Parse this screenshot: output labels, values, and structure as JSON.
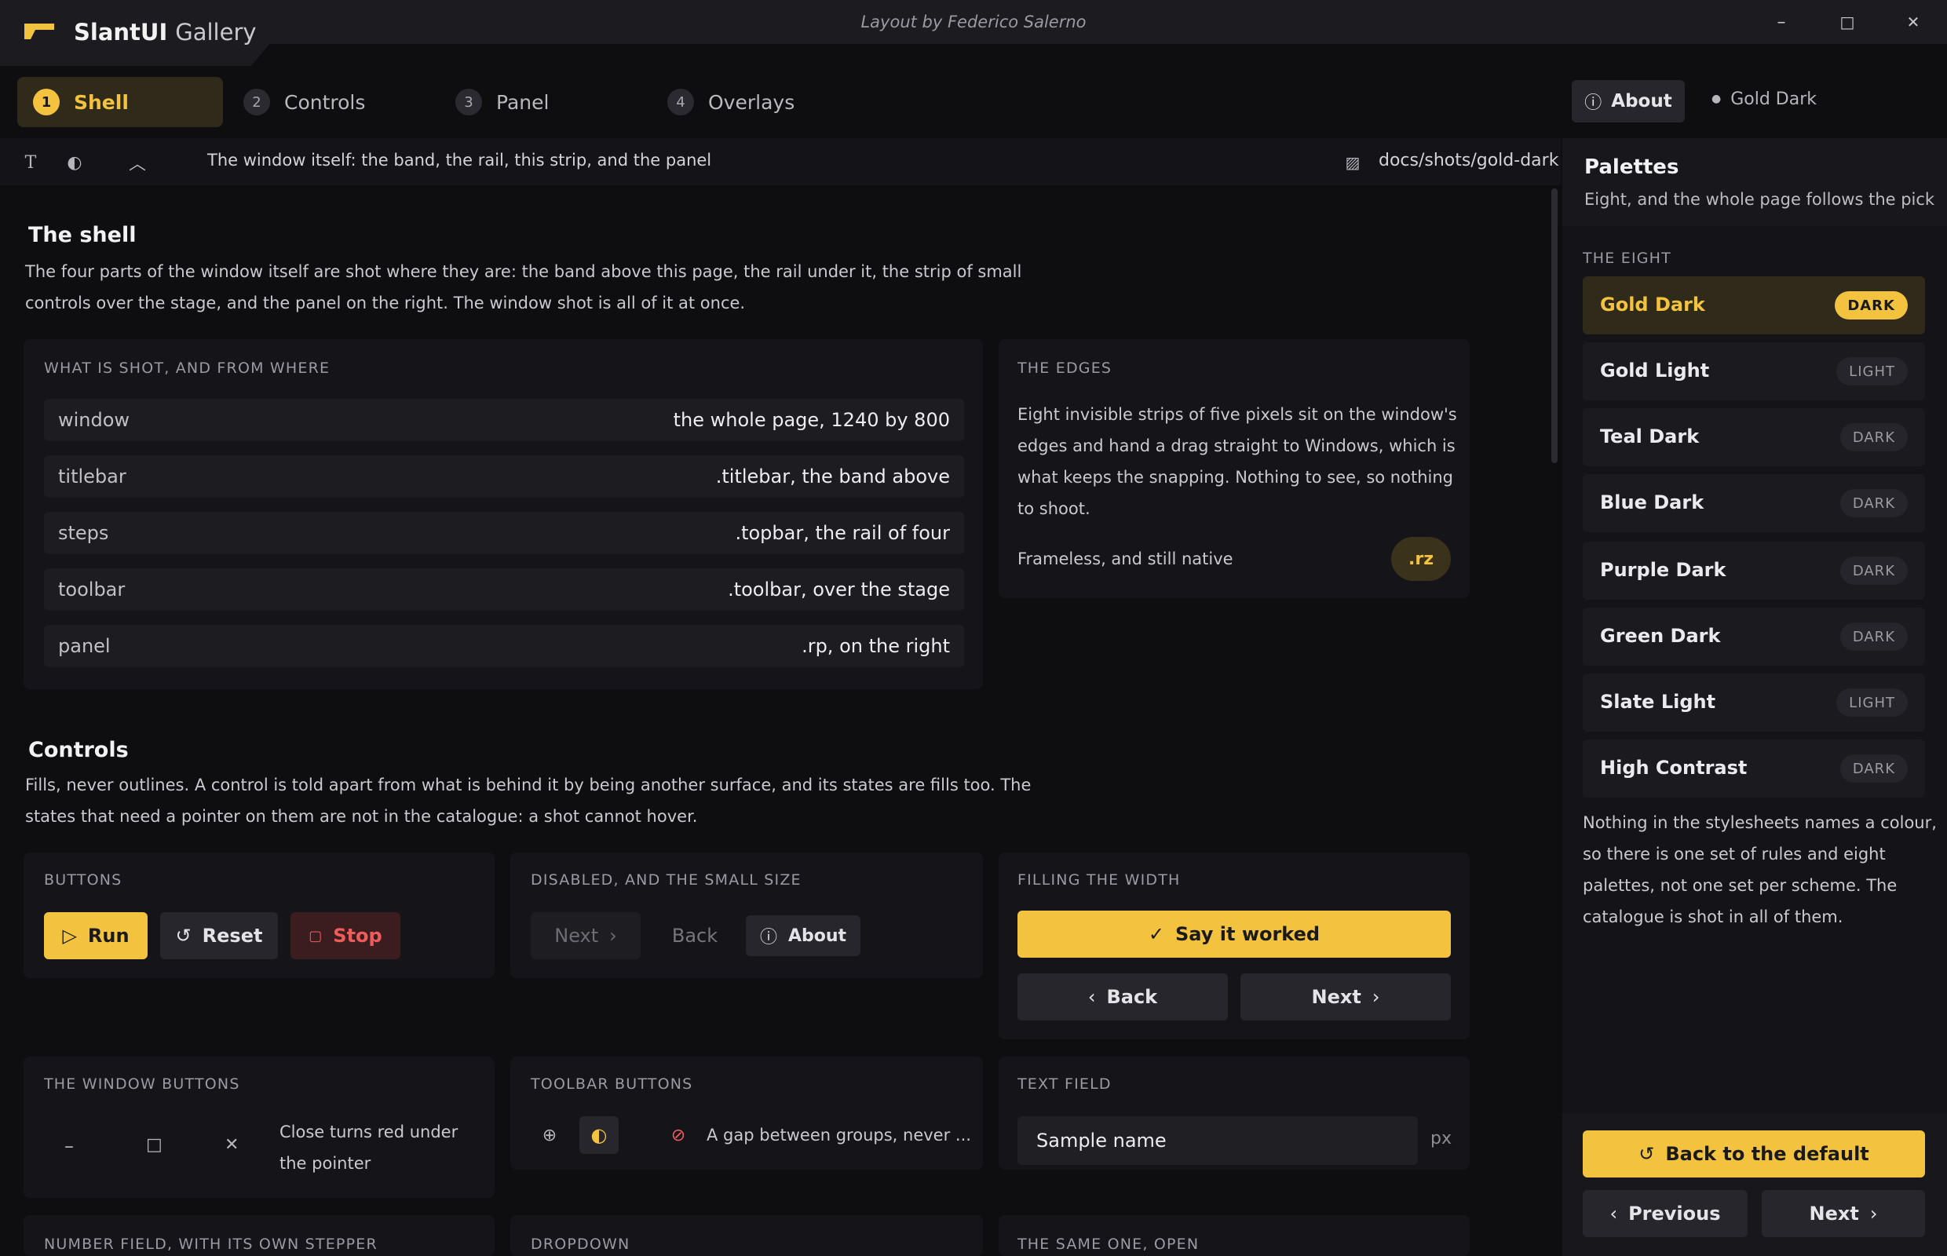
{
  "app": {
    "name": "SlantUI",
    "subtitle": "Gallery",
    "credit": "Layout by Federico Salerno"
  },
  "window_buttons": {
    "minimize": "–",
    "maximize": "□",
    "close": "✕"
  },
  "steps": [
    {
      "num": "1",
      "label": "Shell"
    },
    {
      "num": "2",
      "label": "Controls"
    },
    {
      "num": "3",
      "label": "Panel"
    },
    {
      "num": "4",
      "label": "Overlays"
    }
  ],
  "header_right": {
    "about_label": "About",
    "theme_label": "Gold Dark"
  },
  "toolbar": {
    "caption": "The window itself: the band, the rail, this strip, and the panel",
    "path": "docs/shots/gold-dark"
  },
  "shell": {
    "title": "The shell",
    "desc_line1": "The four parts of the window itself are shot where they are: the band above this page, the rail under it, the strip of small",
    "desc_line2": "controls over the stage, and the panel on the right. The window shot is all of it at once.",
    "table_caption": "What is shot, and from where",
    "rows": [
      {
        "k": "window",
        "v": "the whole page, 1240 by 800"
      },
      {
        "k": "titlebar",
        "v": ".titlebar, the band above"
      },
      {
        "k": "steps",
        "v": ".topbar, the rail of four"
      },
      {
        "k": "toolbar",
        "v": ".toolbar, over the stage"
      },
      {
        "k": "panel",
        "v": ".rp, on the right"
      }
    ],
    "edges_caption": "The edges",
    "edges_l1": "Eight invisible strips of five pixels sit on the window's",
    "edges_l2": "edges and hand a drag straight to Windows, which is",
    "edges_l3": "what keeps the snapping. Nothing to see, so nothing",
    "edges_l4": "to shoot.",
    "edges_note": "Frameless, and still native",
    "edges_badge": ".rz"
  },
  "controls": {
    "title": "Controls",
    "desc_line1": "Fills, never outlines. A control is told apart from what is behind it by being another surface, and its states are fills too. The",
    "desc_line2": "states that need a pointer on them are not in the catalogue: a shot cannot hover.",
    "buttons_caption": "Buttons",
    "run": "Run",
    "reset": "Reset",
    "stop": "Stop",
    "disabled_caption": "Disabled, and the small size",
    "next": "Next",
    "back": "Back",
    "about": "About",
    "fill_caption": "Filling the width",
    "say": "Say it worked",
    "winbtn_caption": "The window buttons",
    "winbtn_note_l1": "Close turns red under",
    "winbtn_note_l2": "the pointer",
    "tbbtn_caption": "Toolbar buttons",
    "tbbtn_note": "A gap between groups, never ...",
    "textfield_caption": "Text field",
    "textfield_value": "Sample name",
    "textfield_unit": "px",
    "number_caption": "Number field, with its own stepper",
    "dropdown_caption": "Dropdown",
    "open_caption": "The same one, open"
  },
  "panel": {
    "title": "Palettes",
    "subtitle": "Eight, and the whole page follows the pick",
    "section": "The eight",
    "palettes": [
      {
        "name": "Gold Dark",
        "scheme": "DARK"
      },
      {
        "name": "Gold Light",
        "scheme": "LIGHT"
      },
      {
        "name": "Teal Dark",
        "scheme": "DARK"
      },
      {
        "name": "Blue Dark",
        "scheme": "DARK"
      },
      {
        "name": "Purple Dark",
        "scheme": "DARK"
      },
      {
        "name": "Green Dark",
        "scheme": "DARK"
      },
      {
        "name": "Slate Light",
        "scheme": "LIGHT"
      },
      {
        "name": "High Contrast",
        "scheme": "DARK"
      }
    ],
    "note_l1": "Nothing in the stylesheets names a colour,",
    "note_l2": "so there is one set of rules and eight",
    "note_l3": "palettes, not one set per scheme. The",
    "note_l4": "catalogue is shot in all of them.",
    "default_btn": "Back to the default",
    "previous": "Previous",
    "next": "Next"
  },
  "colors": {
    "accent": "#f3c23e",
    "bg": "#0e0e11",
    "surface": "#151519",
    "danger": "#ef5c5c"
  },
  "icons": [
    "logo-icon",
    "text-icon",
    "contrast-icon",
    "chevron-up-icon",
    "image-icon",
    "info-icon",
    "play-icon",
    "reset-icon",
    "stop-icon",
    "check-icon",
    "zoom-in-icon",
    "block-icon"
  ]
}
